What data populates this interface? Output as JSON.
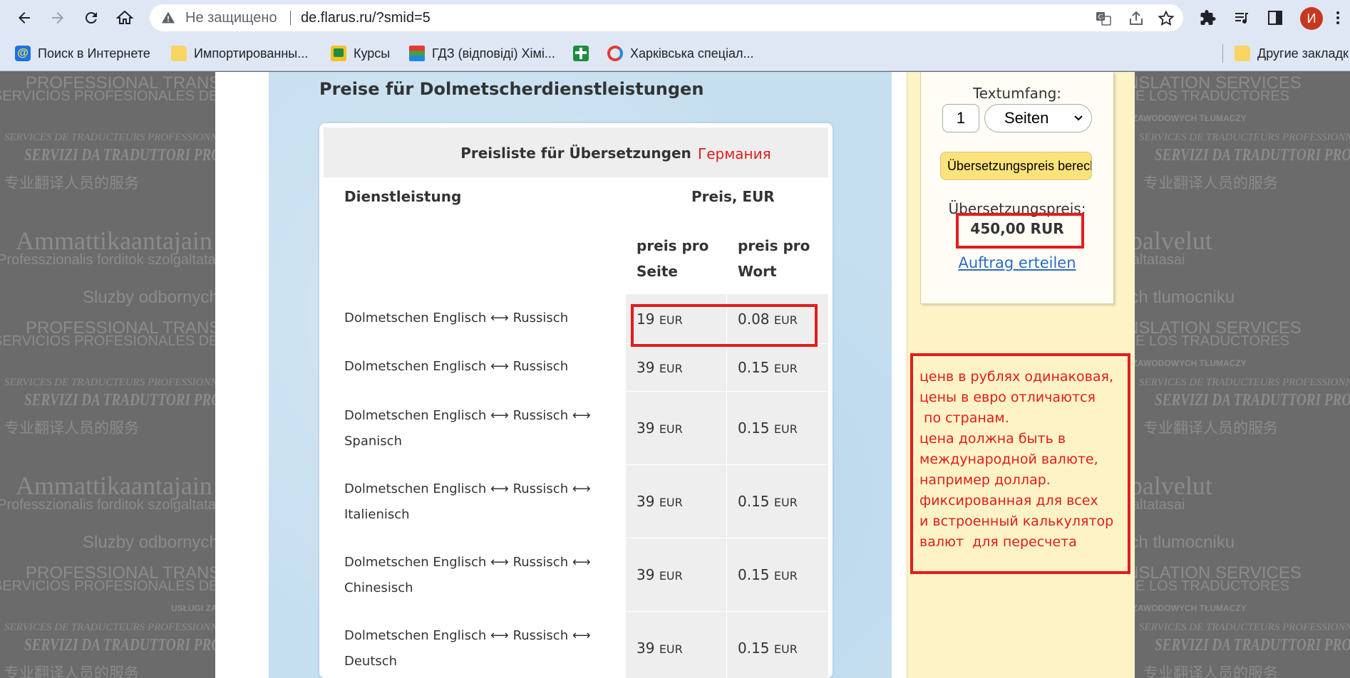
{
  "browser": {
    "security_label": "Не защищено",
    "url": "de.flarus.ru/?smid=5",
    "avatar_letter": "И",
    "bookmarks": [
      {
        "label": "Поиск в Интернете",
        "icon": "search-engine-icon"
      },
      {
        "label": "Импортированны...",
        "icon": "folder-icon"
      },
      {
        "label": "Курсы",
        "icon": "classroom-icon"
      },
      {
        "label": "ГДЗ (відповіді) Хімі...",
        "icon": "books-icon"
      },
      {
        "label": "",
        "icon": "green-plus-icon"
      },
      {
        "label": "Харківська спеціал...",
        "icon": "refresh-logo-icon"
      }
    ],
    "other_bookmarks": "Другие закладк"
  },
  "watermark": {
    "line1": "PROFESSIONAL TRANSLATION SERVICES",
    "line2": "SERVICIOS PROFESIONALES DE LOS TRADUCTORES",
    "line3": "USŁUGI ZAWODOWYCH TŁUMACZY",
    "line4": "SERVICES DE TRADUCTEURS PROFESSIONNELS",
    "line5": "SERVIZI DA TRADUTTORI PROFESSIONISTI",
    "line6": "专业翻译人员的服务",
    "line7": "Ammattikaantajain palvelut",
    "line8": "Professzionalis forditok szolgaltatasai",
    "line9": "Sluzby odbornych tlumocniku"
  },
  "page": {
    "heading": "Preise für Dolmetscherdienstleistungen",
    "table_title": "Preisliste für Übersetzungen",
    "annotation_country": "Германия",
    "col_service": "Dienstleistung",
    "col_price": "Preis, EUR",
    "sub_page": "preis pro Seite",
    "sub_word": "preis pro Wort",
    "currency": "EUR",
    "rows": [
      {
        "service": "Dolmetschen Englisch ⟷ Russisch",
        "per_page": "19",
        "per_word": "0.08"
      },
      {
        "service": "Dolmetschen Englisch ⟷ Russisch",
        "per_page": "39",
        "per_word": "0.15"
      },
      {
        "service": "Dolmetschen Englisch ⟷ Russisch ⟷ Spanisch",
        "per_page": "39",
        "per_word": "0.15"
      },
      {
        "service": "Dolmetschen Englisch ⟷ Russisch ⟷ Italienisch",
        "per_page": "39",
        "per_word": "0.15"
      },
      {
        "service": "Dolmetschen Englisch ⟷ Russisch ⟷ Chinesisch",
        "per_page": "39",
        "per_word": "0.15"
      },
      {
        "service": "Dolmetschen Englisch ⟷ Russisch ⟷ Deutsch",
        "per_page": "39",
        "per_word": "0.15"
      }
    ]
  },
  "calculator": {
    "volume_label": "Textumfang:",
    "quantity": "1",
    "unit": "Seiten",
    "calculate_button": "Übersetzungspreis berechnen",
    "result_label": "Übersetzungspreis:",
    "result_value": "450,00 RUR",
    "order_link": "Auftrag erteilen"
  },
  "annotation_note": "ценв в рублях одинаковая,\nцены в евро отличаются\n по странам.\nцена должна быть в\nмеждународной валюте,\nнапример доллар.\nфиксированная для всех\nи встроенный калькулятор\nвалют  для пересчета",
  "colors": {
    "annotation_red": "#e31c1c",
    "link_blue": "#2b6cc4",
    "button_yellow": "#fbe27a"
  }
}
